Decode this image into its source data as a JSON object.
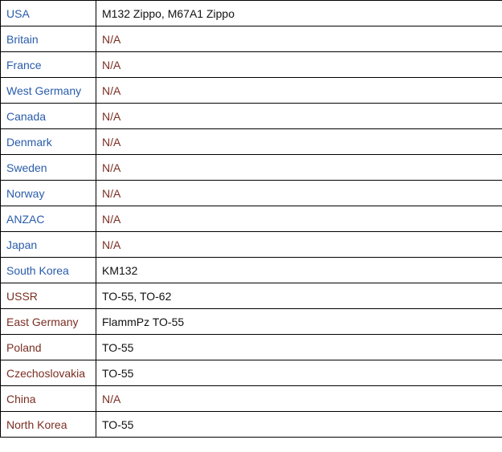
{
  "colors": {
    "country_blue": "#2a5caa",
    "country_maroon": "#7a2e22",
    "value_na": "#7a2e22",
    "value_text": "#111111",
    "border": "#000000"
  },
  "rows": [
    {
      "country": "USA",
      "country_color": "blue",
      "value": "M132 Zippo, M67A1 Zippo",
      "value_color": "black"
    },
    {
      "country": "Britain",
      "country_color": "blue",
      "value": "N/A",
      "value_color": "maroon"
    },
    {
      "country": "France",
      "country_color": "blue",
      "value": "N/A",
      "value_color": "maroon"
    },
    {
      "country": "West Germany",
      "country_color": "blue",
      "value": "N/A",
      "value_color": "maroon"
    },
    {
      "country": "Canada",
      "country_color": "blue",
      "value": "N/A",
      "value_color": "maroon"
    },
    {
      "country": "Denmark",
      "country_color": "blue",
      "value": "N/A",
      "value_color": "maroon"
    },
    {
      "country": "Sweden",
      "country_color": "blue",
      "value": "N/A",
      "value_color": "maroon"
    },
    {
      "country": "Norway",
      "country_color": "blue",
      "value": "N/A",
      "value_color": "maroon"
    },
    {
      "country": "ANZAC",
      "country_color": "blue",
      "value": "N/A",
      "value_color": "maroon"
    },
    {
      "country": "Japan",
      "country_color": "blue",
      "value": "N/A",
      "value_color": "maroon"
    },
    {
      "country": "South Korea",
      "country_color": "blue",
      "value": "KM132",
      "value_color": "black"
    },
    {
      "country": "USSR",
      "country_color": "maroon",
      "value": "TO-55, TO-62",
      "value_color": "black"
    },
    {
      "country": "East Germany",
      "country_color": "maroon",
      "value": "FlammPz TO-55",
      "value_color": "black"
    },
    {
      "country": "Poland",
      "country_color": "maroon",
      "value": "TO-55",
      "value_color": "black"
    },
    {
      "country": "Czechoslovakia",
      "country_color": "maroon",
      "value": "TO-55",
      "value_color": "black"
    },
    {
      "country": "China",
      "country_color": "maroon",
      "value": "N/A",
      "value_color": "maroon"
    },
    {
      "country": "North Korea",
      "country_color": "maroon",
      "value": "TO-55",
      "value_color": "black"
    }
  ]
}
